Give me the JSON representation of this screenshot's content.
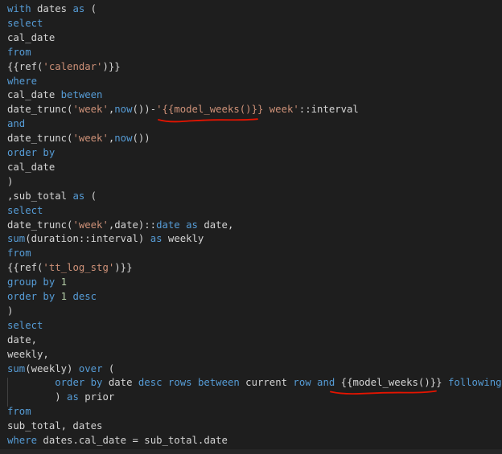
{
  "colors": {
    "background": "#1e1e1e",
    "default_text": "#d4d4d4",
    "keyword": "#569cd6",
    "string": "#ce9178",
    "number": "#b5cea8",
    "squiggle": "#e51400"
  },
  "code_lines": [
    {
      "tokens": [
        {
          "text": "with",
          "type": "keyword"
        },
        {
          "text": " dates ",
          "type": "plain"
        },
        {
          "text": "as",
          "type": "keyword"
        },
        {
          "text": " (",
          "type": "plain"
        }
      ]
    },
    {
      "tokens": [
        {
          "text": "select",
          "type": "keyword"
        }
      ]
    },
    {
      "tokens": [
        {
          "text": "cal_date",
          "type": "plain"
        }
      ]
    },
    {
      "tokens": [
        {
          "text": "from",
          "type": "keyword"
        }
      ]
    },
    {
      "tokens": [
        {
          "text": "{{ref(",
          "type": "plain"
        },
        {
          "text": "'calendar'",
          "type": "string"
        },
        {
          "text": ")}}",
          "type": "plain"
        }
      ]
    },
    {
      "tokens": [
        {
          "text": "where",
          "type": "keyword"
        }
      ]
    },
    {
      "tokens": [
        {
          "text": "cal_date ",
          "type": "plain"
        },
        {
          "text": "between",
          "type": "keyword"
        }
      ]
    },
    {
      "tokens": [
        {
          "text": "date_trunc(",
          "type": "plain"
        },
        {
          "text": "'week'",
          "type": "string"
        },
        {
          "text": ",",
          "type": "plain"
        },
        {
          "text": "now",
          "type": "keyword"
        },
        {
          "text": "())-",
          "type": "plain"
        },
        {
          "text": "'{{model_weeks()}} week'",
          "type": "string"
        },
        {
          "text": "::interval",
          "type": "plain"
        }
      ]
    },
    {
      "tokens": [
        {
          "text": "and",
          "type": "keyword"
        }
      ]
    },
    {
      "tokens": [
        {
          "text": "date_trunc(",
          "type": "plain"
        },
        {
          "text": "'week'",
          "type": "string"
        },
        {
          "text": ",",
          "type": "plain"
        },
        {
          "text": "now",
          "type": "keyword"
        },
        {
          "text": "())",
          "type": "plain"
        }
      ]
    },
    {
      "tokens": [
        {
          "text": "order by",
          "type": "keyword"
        }
      ]
    },
    {
      "tokens": [
        {
          "text": "cal_date",
          "type": "plain"
        }
      ]
    },
    {
      "tokens": [
        {
          "text": ")",
          "type": "plain"
        }
      ]
    },
    {
      "tokens": [
        {
          "text": ",sub_total ",
          "type": "plain"
        },
        {
          "text": "as",
          "type": "keyword"
        },
        {
          "text": " (",
          "type": "plain"
        }
      ]
    },
    {
      "tokens": [
        {
          "text": "select",
          "type": "keyword"
        }
      ]
    },
    {
      "tokens": [
        {
          "text": "date_trunc(",
          "type": "plain"
        },
        {
          "text": "'week'",
          "type": "string"
        },
        {
          "text": ",date)::",
          "type": "plain"
        },
        {
          "text": "date",
          "type": "keyword"
        },
        {
          "text": " ",
          "type": "plain"
        },
        {
          "text": "as",
          "type": "keyword"
        },
        {
          "text": " date,",
          "type": "plain"
        }
      ]
    },
    {
      "tokens": [
        {
          "text": "sum",
          "type": "keyword"
        },
        {
          "text": "(duration::interval) ",
          "type": "plain"
        },
        {
          "text": "as",
          "type": "keyword"
        },
        {
          "text": " weekly",
          "type": "plain"
        }
      ]
    },
    {
      "tokens": [
        {
          "text": "from",
          "type": "keyword"
        }
      ]
    },
    {
      "tokens": [
        {
          "text": "{{ref(",
          "type": "plain"
        },
        {
          "text": "'tt_log_stg'",
          "type": "string"
        },
        {
          "text": ")}}",
          "type": "plain"
        }
      ]
    },
    {
      "tokens": [
        {
          "text": "group by",
          "type": "keyword"
        },
        {
          "text": " ",
          "type": "plain"
        },
        {
          "text": "1",
          "type": "number"
        }
      ]
    },
    {
      "tokens": [
        {
          "text": "order by",
          "type": "keyword"
        },
        {
          "text": " ",
          "type": "plain"
        },
        {
          "text": "1",
          "type": "number"
        },
        {
          "text": " ",
          "type": "plain"
        },
        {
          "text": "desc",
          "type": "keyword"
        }
      ]
    },
    {
      "tokens": [
        {
          "text": ")",
          "type": "plain"
        }
      ]
    },
    {
      "tokens": [
        {
          "text": "select",
          "type": "keyword"
        }
      ]
    },
    {
      "tokens": [
        {
          "text": "date,",
          "type": "plain"
        }
      ]
    },
    {
      "tokens": [
        {
          "text": "weekly,",
          "type": "plain"
        }
      ]
    },
    {
      "tokens": [
        {
          "text": "sum",
          "type": "keyword"
        },
        {
          "text": "(weekly) ",
          "type": "plain"
        },
        {
          "text": "over",
          "type": "keyword"
        },
        {
          "text": " (",
          "type": "plain"
        }
      ]
    },
    {
      "tokens": [
        {
          "text": "        ",
          "type": "plain"
        },
        {
          "text": "order by",
          "type": "keyword"
        },
        {
          "text": " date ",
          "type": "plain"
        },
        {
          "text": "desc",
          "type": "keyword"
        },
        {
          "text": " ",
          "type": "plain"
        },
        {
          "text": "rows",
          "type": "keyword"
        },
        {
          "text": " ",
          "type": "plain"
        },
        {
          "text": "between",
          "type": "keyword"
        },
        {
          "text": " current ",
          "type": "plain"
        },
        {
          "text": "row",
          "type": "keyword"
        },
        {
          "text": " ",
          "type": "plain"
        },
        {
          "text": "and",
          "type": "keyword"
        },
        {
          "text": " {{model_weeks()}} ",
          "type": "plain"
        },
        {
          "text": "following",
          "type": "keyword"
        }
      ]
    },
    {
      "tokens": [
        {
          "text": "        ) ",
          "type": "plain"
        },
        {
          "text": "as",
          "type": "keyword"
        },
        {
          "text": " prior",
          "type": "plain"
        }
      ]
    },
    {
      "tokens": [
        {
          "text": "from",
          "type": "keyword"
        }
      ]
    },
    {
      "tokens": [
        {
          "text": "sub_total, dates",
          "type": "plain"
        }
      ]
    },
    {
      "tokens": [
        {
          "text": "where",
          "type": "keyword"
        },
        {
          "text": " dates.cal_date = sub_total.date",
          "type": "plain"
        }
      ]
    }
  ]
}
